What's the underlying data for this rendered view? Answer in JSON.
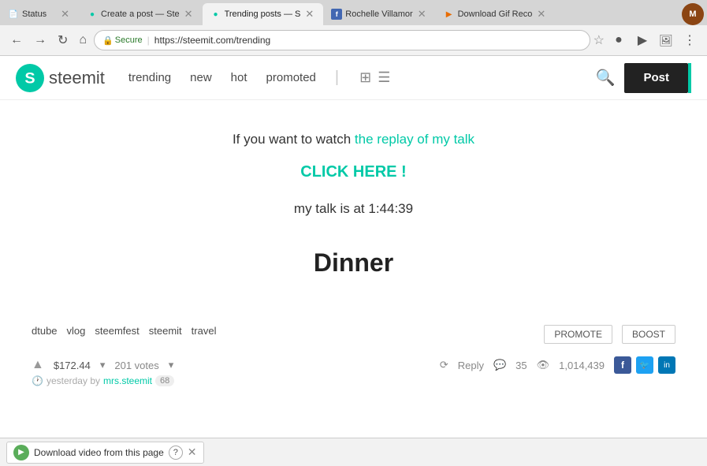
{
  "browser": {
    "tabs": [
      {
        "id": "tab-status",
        "label": "Status",
        "favicon": "📄",
        "favicon_type": "default",
        "active": false
      },
      {
        "id": "tab-create",
        "label": "Create a post — Ste",
        "favicon": "✏️",
        "favicon_type": "green",
        "active": false
      },
      {
        "id": "tab-trending",
        "label": "Trending posts — S",
        "favicon": "🔵",
        "favicon_type": "green",
        "active": true
      },
      {
        "id": "tab-rochelle",
        "label": "Rochelle Villamor",
        "favicon": "f",
        "favicon_type": "blue",
        "active": false
      },
      {
        "id": "tab-gif",
        "label": "Download Gif Reco",
        "favicon": "🟠",
        "favicon_type": "orange",
        "active": false
      }
    ],
    "url": "https://steemit.com/trending",
    "secure_label": "Secure"
  },
  "steemit": {
    "logo_text": "steemit",
    "nav": {
      "trending": "trending",
      "new": "new",
      "hot": "hot",
      "promoted": "promoted"
    },
    "post_button": "Post",
    "search_placeholder": "Search"
  },
  "post": {
    "watch_prefix": "If you want to watch ",
    "watch_link": "the replay of my talk",
    "click_here": "CLICK HERE !",
    "talk_time": "my talk is at 1:44:39",
    "dinner_title": "Dinner",
    "tags": [
      "dtube",
      "vlog",
      "steemfest",
      "steemit",
      "travel"
    ],
    "promote_btn": "PROMOTE",
    "boost_btn": "BOOST",
    "amount": "$172.44",
    "votes": "201 votes",
    "comment_count": "35",
    "views": "1,014,439",
    "reply": "Reply",
    "author": "mrs.steemit",
    "timestamp": "yesterday by"
  },
  "download_bar": {
    "label": "Download video from this page",
    "help": "?",
    "close": "✕"
  }
}
